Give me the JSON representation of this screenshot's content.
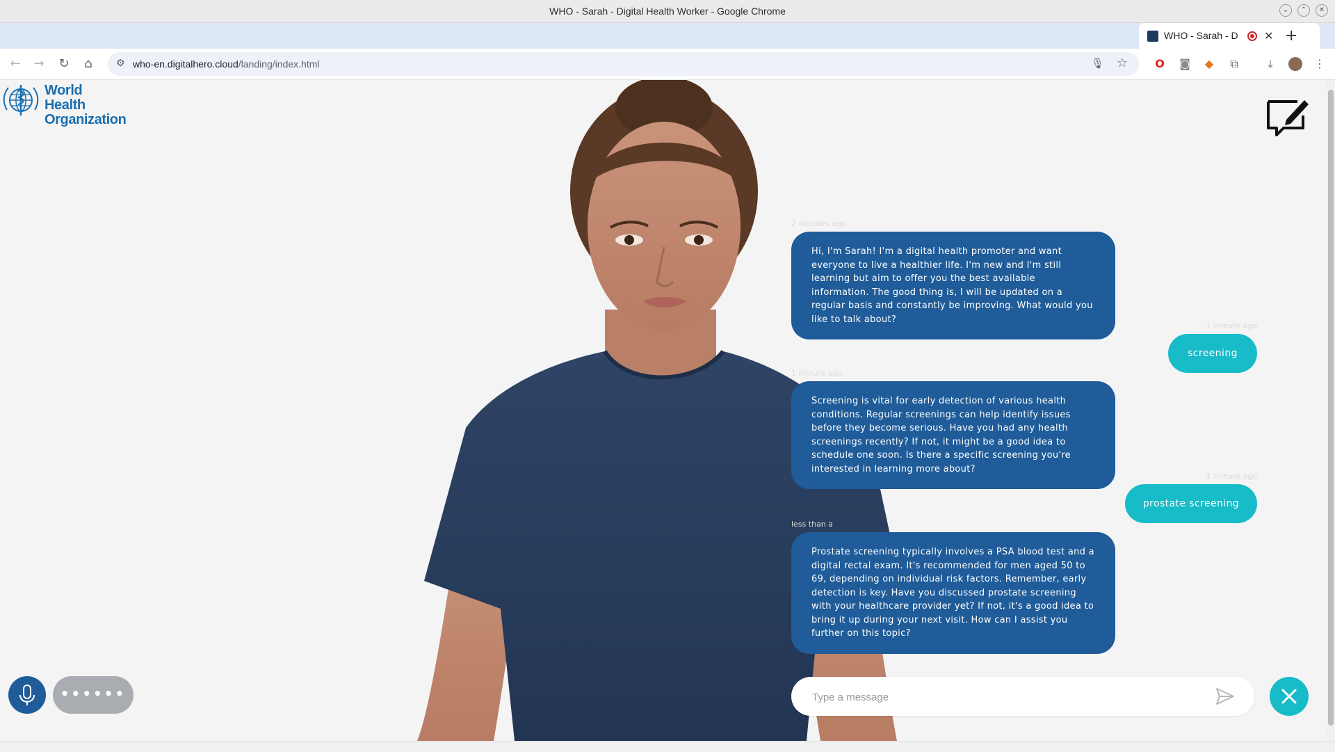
{
  "window": {
    "title": "WHO - Sarah - Digital Health Worker - Google Chrome"
  },
  "tab": {
    "title": "WHO - Sarah - D",
    "close_glyph": "✕",
    "new_tab_glyph": "+"
  },
  "toolbar": {
    "url_host": "who-en.digitalhero.cloud",
    "url_path": "/landing/index.html"
  },
  "logo": {
    "line1": "World Health",
    "line2": "Organization"
  },
  "chat": {
    "messages": [
      {
        "from": "bot",
        "time": "2 minutes ago",
        "text": "Hi, I'm Sarah! I'm a digital health promoter and want everyone to live a healthier life. I'm new and I'm still learning but aim to offer you the best available information. The good thing is, I will be updated on a regular basis and constantly be improving. What would you like to talk about?"
      },
      {
        "from": "user",
        "time": "1 minute ago",
        "text": "screening"
      },
      {
        "from": "bot",
        "time": "1 minute ago",
        "text": "Screening is vital for early detection of various health conditions. Regular screenings can help identify issues before they become serious. Have you had any health screenings recently? If not, it might be a good idea to schedule one soon. Is there a specific screening you're interested in learning more about?"
      },
      {
        "from": "user",
        "time": "1 minute ago",
        "text": "prostate screening"
      },
      {
        "from": "bot",
        "time": "less than a",
        "text": "Prostate screening typically involves a PSA blood test and a digital rectal exam. It's recommended for men aged 50 to 69, depending on individual risk factors. Remember, early detection is key. Have you discussed prostate screening with your healthcare provider yet? If not, it's a good idea to bring it up during your next visit. How can I assist you further on this topic?"
      }
    ]
  },
  "composer": {
    "placeholder": "Type a message",
    "dots_label": "••••••"
  },
  "colors": {
    "bot_bubble": "#1f5c99",
    "user_bubble": "#17bcc8",
    "who_blue": "#1a6fb0"
  },
  "icons": [
    "back-icon",
    "forward-icon",
    "reload-icon",
    "home-icon",
    "site-info-icon",
    "microphone-icon",
    "star-icon",
    "opera-icon",
    "camera-icon",
    "metamask-icon",
    "extensions-icon",
    "download-icon",
    "profile-avatar",
    "kebab-menu-icon",
    "feedback-icon",
    "send-icon",
    "close-icon"
  ]
}
